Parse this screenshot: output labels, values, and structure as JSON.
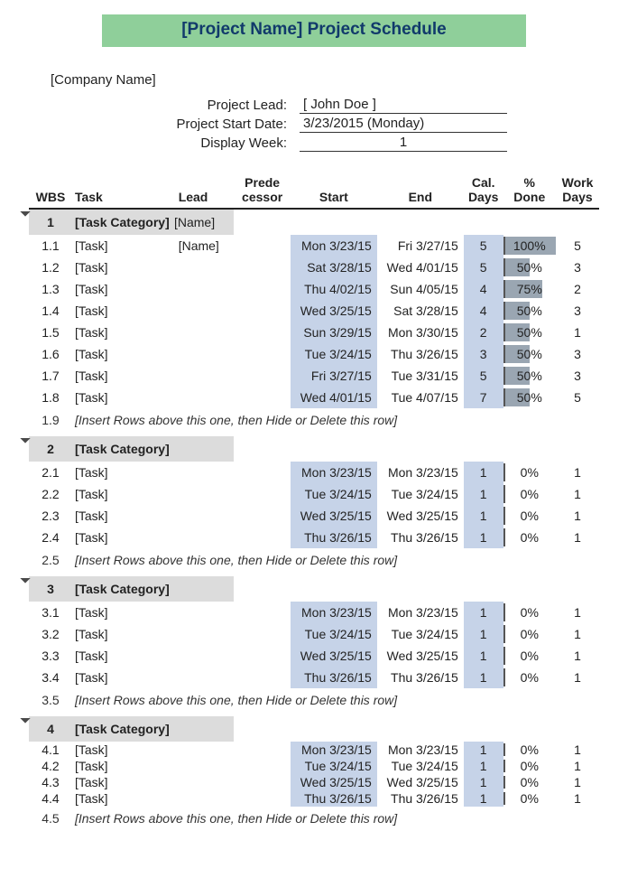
{
  "title": "[Project Name] Project Schedule",
  "company": "[Company Name]",
  "meta": {
    "lead_label": "Project Lead:",
    "lead_value": "[ John Doe ]",
    "start_label": "Project Start Date:",
    "start_value": "3/23/2015 (Monday)",
    "week_label": "Display Week:",
    "week_value": "1"
  },
  "headers": {
    "wbs": "WBS",
    "task": "Task",
    "lead": "Lead",
    "pred1": "Prede",
    "pred2": "cessor",
    "start": "Start",
    "end": "End",
    "cal1": "Cal.",
    "cal2": "Days",
    "pct1": "%",
    "pct2": "Done",
    "work1": "Work",
    "work2": "Days"
  },
  "sections": [
    {
      "wbs": "1",
      "name": "[Task Category]",
      "lead": "[Name]",
      "rows": [
        {
          "wbs": "1.1",
          "task": "[Task]",
          "lead": "[Name]",
          "start": "Mon 3/23/15",
          "end": "Fri 3/27/15",
          "cdays": "5",
          "pct": "100%",
          "pctw": 100,
          "wdays": "5"
        },
        {
          "wbs": "1.2",
          "task": "[Task]",
          "lead": "",
          "start": "Sat 3/28/15",
          "end": "Wed 4/01/15",
          "cdays": "5",
          "pct": "50%",
          "pctw": 50,
          "wdays": "3"
        },
        {
          "wbs": "1.3",
          "task": "[Task]",
          "lead": "",
          "start": "Thu 4/02/15",
          "end": "Sun 4/05/15",
          "cdays": "4",
          "pct": "75%",
          "pctw": 75,
          "wdays": "2"
        },
        {
          "wbs": "1.4",
          "task": "[Task]",
          "lead": "",
          "start": "Wed 3/25/15",
          "end": "Sat 3/28/15",
          "cdays": "4",
          "pct": "50%",
          "pctw": 50,
          "wdays": "3"
        },
        {
          "wbs": "1.5",
          "task": "[Task]",
          "lead": "",
          "start": "Sun 3/29/15",
          "end": "Mon 3/30/15",
          "cdays": "2",
          "pct": "50%",
          "pctw": 50,
          "wdays": "1"
        },
        {
          "wbs": "1.6",
          "task": "[Task]",
          "lead": "",
          "start": "Tue 3/24/15",
          "end": "Thu 3/26/15",
          "cdays": "3",
          "pct": "50%",
          "pctw": 50,
          "wdays": "3"
        },
        {
          "wbs": "1.7",
          "task": "[Task]",
          "lead": "",
          "start": "Fri 3/27/15",
          "end": "Tue 3/31/15",
          "cdays": "5",
          "pct": "50%",
          "pctw": 50,
          "wdays": "3"
        },
        {
          "wbs": "1.8",
          "task": "[Task]",
          "lead": "",
          "start": "Wed 4/01/15",
          "end": "Tue 4/07/15",
          "cdays": "7",
          "pct": "50%",
          "pctw": 50,
          "wdays": "5"
        }
      ],
      "hint_wbs": "1.9",
      "hint": "[Insert Rows above this one, then Hide or Delete this row]"
    },
    {
      "wbs": "2",
      "name": "[Task Category]",
      "lead": "",
      "rows": [
        {
          "wbs": "2.1",
          "task": "[Task]",
          "lead": "",
          "start": "Mon 3/23/15",
          "end": "Mon 3/23/15",
          "cdays": "1",
          "pct": "0%",
          "pctw": 0,
          "wdays": "1"
        },
        {
          "wbs": "2.2",
          "task": "[Task]",
          "lead": "",
          "start": "Tue 3/24/15",
          "end": "Tue 3/24/15",
          "cdays": "1",
          "pct": "0%",
          "pctw": 0,
          "wdays": "1"
        },
        {
          "wbs": "2.3",
          "task": "[Task]",
          "lead": "",
          "start": "Wed 3/25/15",
          "end": "Wed 3/25/15",
          "cdays": "1",
          "pct": "0%",
          "pctw": 0,
          "wdays": "1"
        },
        {
          "wbs": "2.4",
          "task": "[Task]",
          "lead": "",
          "start": "Thu 3/26/15",
          "end": "Thu 3/26/15",
          "cdays": "1",
          "pct": "0%",
          "pctw": 0,
          "wdays": "1"
        }
      ],
      "hint_wbs": "2.5",
      "hint": "[Insert Rows above this one, then Hide or Delete this row]"
    },
    {
      "wbs": "3",
      "name": "[Task Category]",
      "lead": "",
      "rows": [
        {
          "wbs": "3.1",
          "task": "[Task]",
          "lead": "",
          "start": "Mon 3/23/15",
          "end": "Mon 3/23/15",
          "cdays": "1",
          "pct": "0%",
          "pctw": 0,
          "wdays": "1"
        },
        {
          "wbs": "3.2",
          "task": "[Task]",
          "lead": "",
          "start": "Tue 3/24/15",
          "end": "Tue 3/24/15",
          "cdays": "1",
          "pct": "0%",
          "pctw": 0,
          "wdays": "1"
        },
        {
          "wbs": "3.3",
          "task": "[Task]",
          "lead": "",
          "start": "Wed 3/25/15",
          "end": "Wed 3/25/15",
          "cdays": "1",
          "pct": "0%",
          "pctw": 0,
          "wdays": "1"
        },
        {
          "wbs": "3.4",
          "task": "[Task]",
          "lead": "",
          "start": "Thu 3/26/15",
          "end": "Thu 3/26/15",
          "cdays": "1",
          "pct": "0%",
          "pctw": 0,
          "wdays": "1"
        }
      ],
      "hint_wbs": "3.5",
      "hint": "[Insert Rows above this one, then Hide or Delete this row]"
    },
    {
      "wbs": "4",
      "name": "[Task Category]",
      "lead": "",
      "compact": true,
      "rows": [
        {
          "wbs": "4.1",
          "task": "[Task]",
          "lead": "",
          "start": "Mon 3/23/15",
          "end": "Mon 3/23/15",
          "cdays": "1",
          "pct": "0%",
          "pctw": 0,
          "wdays": "1"
        },
        {
          "wbs": "4.2",
          "task": "[Task]",
          "lead": "",
          "start": "Tue 3/24/15",
          "end": "Tue 3/24/15",
          "cdays": "1",
          "pct": "0%",
          "pctw": 0,
          "wdays": "1"
        },
        {
          "wbs": "4.3",
          "task": "[Task]",
          "lead": "",
          "start": "Wed 3/25/15",
          "end": "Wed 3/25/15",
          "cdays": "1",
          "pct": "0%",
          "pctw": 0,
          "wdays": "1"
        },
        {
          "wbs": "4.4",
          "task": "[Task]",
          "lead": "",
          "start": "Thu 3/26/15",
          "end": "Thu 3/26/15",
          "cdays": "1",
          "pct": "0%",
          "pctw": 0,
          "wdays": "1"
        }
      ],
      "hint_wbs": "4.5",
      "hint": "[Insert Rows above this one, then Hide or Delete this row]"
    }
  ]
}
